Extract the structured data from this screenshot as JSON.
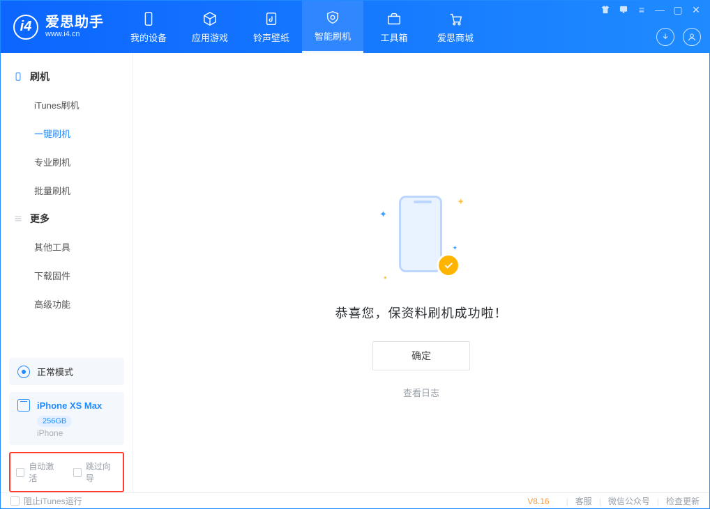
{
  "app": {
    "title": "爱思助手",
    "subtitle": "www.i4.cn"
  },
  "tabs": {
    "device": {
      "label": "我的设备"
    },
    "apps": {
      "label": "应用游戏"
    },
    "ring": {
      "label": "铃声壁纸"
    },
    "flash": {
      "label": "智能刷机"
    },
    "toolbox": {
      "label": "工具箱"
    },
    "store": {
      "label": "爱思商城"
    }
  },
  "sidebar": {
    "flash_section": "刷机",
    "items": {
      "itunes": "iTunes刷机",
      "oneclick": "一键刷机",
      "pro": "专业刷机",
      "batch": "批量刷机"
    },
    "more_section": "更多",
    "more": {
      "other": "其他工具",
      "firmware": "下载固件",
      "adv": "高级功能"
    },
    "mode": "正常模式",
    "device": {
      "name": "iPhone XS Max",
      "capacity": "256GB",
      "type": "iPhone"
    },
    "options": {
      "auto_activate": "自动激活",
      "skip_guide": "跳过向导"
    }
  },
  "main": {
    "success_text": "恭喜您，保资料刷机成功啦！",
    "ok_label": "确定",
    "log_link": "查看日志"
  },
  "footer": {
    "block_itunes": "阻止iTunes运行",
    "version": "V8.16",
    "support": "客服",
    "wechat": "微信公众号",
    "update": "检查更新"
  }
}
